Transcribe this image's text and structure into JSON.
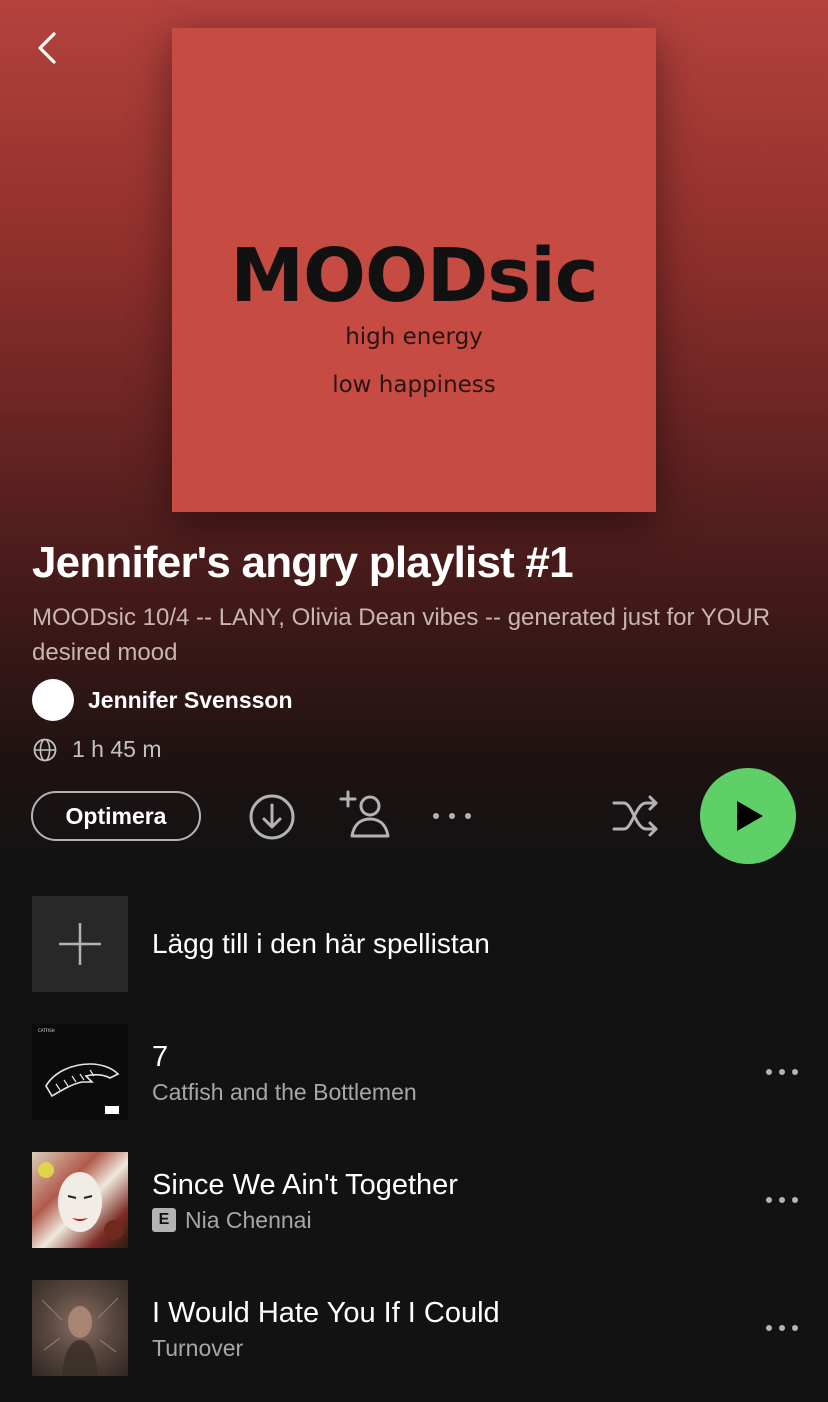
{
  "cover": {
    "title": "MOODsic",
    "subtitle_1": "high energy",
    "subtitle_2": "low happiness",
    "background_color": "#c64b43"
  },
  "playlist": {
    "title": "Jennifer's angry playlist #1",
    "description": "MOODsic 10/4 -- LANY, Olivia Dean vibes -- generated just for YOUR desired mood",
    "owner": "Jennifer Svensson",
    "duration": "1 h 45 m"
  },
  "controls": {
    "optimize_label": "Optimera",
    "accent_color": "#5fd068",
    "icons": [
      "back-icon",
      "globe-icon",
      "download-icon",
      "add-user-icon",
      "more-icon",
      "shuffle-icon",
      "play-icon",
      "plus-icon"
    ]
  },
  "add_row": {
    "label": "Lägg till i den här spellistan"
  },
  "tracks": [
    {
      "title": "7",
      "artist": "Catfish and the Bottlemen",
      "explicit": false
    },
    {
      "title": "Since We Ain't Together",
      "artist": "Nia Chennai",
      "explicit": true,
      "explicit_label": "E"
    },
    {
      "title": "I Would Hate You If I Could",
      "artist": "Turnover",
      "explicit": false
    }
  ]
}
